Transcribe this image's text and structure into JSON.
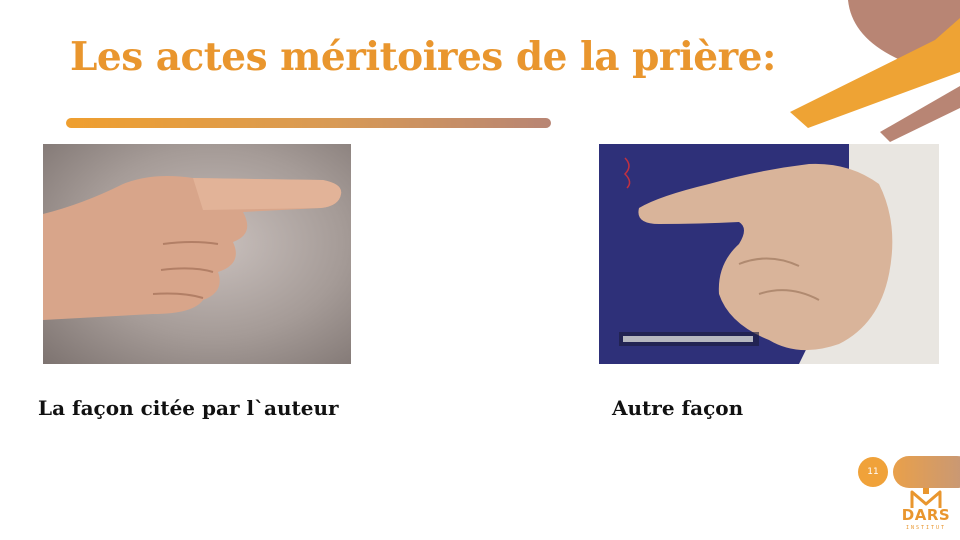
{
  "slide": {
    "title": "Les actes méritoires de la prière:",
    "page_number": "11"
  },
  "images": {
    "left": {
      "caption": "La façon citée par l`auteur",
      "icon": "pointing-finger-photo"
    },
    "right": {
      "caption": "Autre façon",
      "icon": "pointing-finger-bent-photo"
    }
  },
  "logo": {
    "name": "DARS",
    "subtitle": "INSTITUT"
  },
  "colors": {
    "accent_orange": "#e9962e",
    "accent_brown": "#b88574",
    "text": "#111111",
    "background": "#ffffff"
  }
}
